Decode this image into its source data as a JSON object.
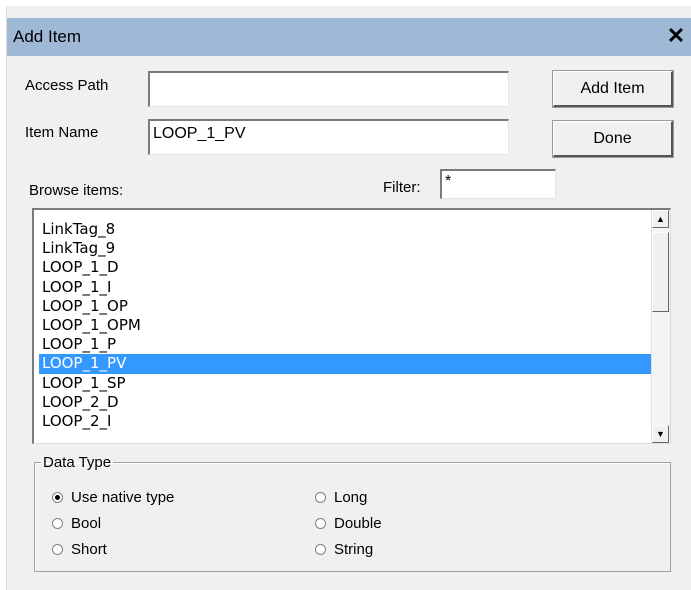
{
  "window": {
    "title": "Add Item",
    "close_glyph": "✕"
  },
  "form": {
    "access_path_label": "Access Path",
    "access_path_value": "",
    "item_name_label": "Item Name",
    "item_name_value": "LOOP_1_PV",
    "browse_label": "Browse items:",
    "filter_label": "Filter:",
    "filter_value": "*"
  },
  "buttons": {
    "add_item": "Add Item",
    "done": "Done"
  },
  "browse_list": {
    "items": [
      "LinkTag_8",
      "LinkTag_9",
      "LOOP_1_D",
      "LOOP_1_I",
      "LOOP_1_OP",
      "LOOP_1_OPM",
      "LOOP_1_P",
      "LOOP_1_PV",
      "LOOP_1_SP",
      "LOOP_2_D",
      "LOOP_2_I"
    ],
    "selected": "LOOP_1_PV",
    "scroll_up_glyph": "▲",
    "scroll_down_glyph": "▼"
  },
  "data_type": {
    "legend": "Data Type",
    "options": [
      "Use native type",
      "Bool",
      "Short",
      "Long",
      "Double",
      "String"
    ],
    "selected": "Use native type"
  },
  "colors": {
    "title_bar": "#9fb8d6",
    "selection": "#3399ff",
    "dialog_bg": "#f0f0f0"
  }
}
